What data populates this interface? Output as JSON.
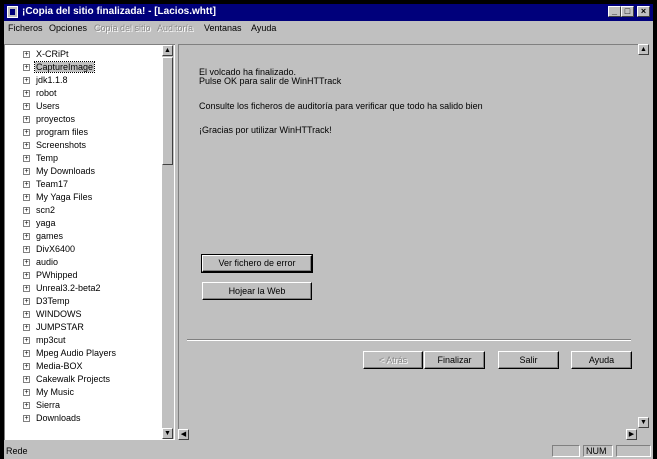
{
  "window": {
    "title": "¡Copia del sitio finalizada! - [Lacios.whtt]",
    "controls": {
      "minimize": "_",
      "maximize": "□",
      "close": "×"
    }
  },
  "menu": [
    {
      "label": "Ficheros",
      "enabled": true
    },
    {
      "label": "Opciones",
      "enabled": true
    },
    {
      "label": "Copia del sitio",
      "enabled": false
    },
    {
      "label": "Auditoría",
      "enabled": false
    },
    {
      "label": "Ventanas",
      "enabled": true
    },
    {
      "label": "Ayuda",
      "enabled": true
    }
  ],
  "tree": {
    "expand_glyph": "+",
    "items": [
      "X-CRiPt",
      "CaptureImage",
      "jdk1.1.8",
      "robot",
      "Users",
      "proyectos",
      "program files",
      "Screenshots",
      "Temp",
      "My Downloads",
      "Team17",
      "My Yaga Files",
      "scn2",
      "yaga",
      "games",
      "DivX6400",
      "audio",
      "PWhipped",
      "Unreal3.2-beta2",
      "D3Temp",
      "WINDOWS",
      "JUMPSTAR",
      "mp3cut",
      "Mpeg Audio Players",
      "Media-BOX",
      "Cakewalk Projects",
      "My Music",
      "Sierra",
      "Downloads"
    ],
    "selected_index": 1
  },
  "messages": {
    "line1": "El volcado ha finalizado.",
    "line2": "Pulse OK para salir de WinHTTrack",
    "line3": "Consulte los ficheros de auditoría para verificar que todo ha salido bien",
    "line4": "¡Gracias por utilizar WinHTTrack!"
  },
  "buttons": {
    "view_errors": "Ver fichero de error",
    "browse_web": "Hojear la Web",
    "back": "< Atrás",
    "finish": "Finalizar",
    "exit": "Salir",
    "help": "Ayuda"
  },
  "statusbar": {
    "text": "Rede",
    "num": "NUM"
  }
}
